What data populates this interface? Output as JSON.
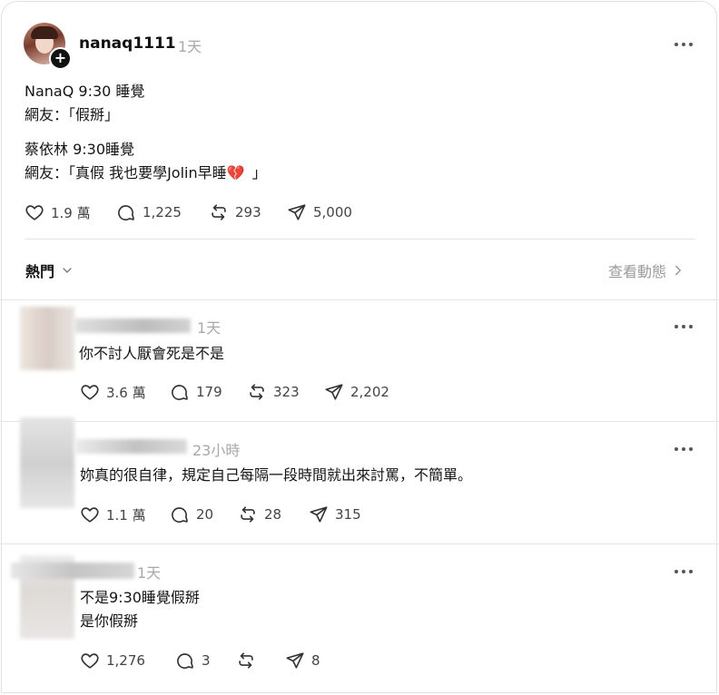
{
  "post": {
    "username": "nanaq1111",
    "time": "1天",
    "lines": [
      "NanaQ 9:30 睡覺",
      "網友：「假掰」",
      "蔡依林 9:30睡覺",
      "網友：「真假 我也要學Jolin早睡",
      "」"
    ],
    "heart_emoji": "💔",
    "likes": "1.9 萬",
    "replies": "1,225",
    "reposts": "293",
    "shares": "5,000"
  },
  "sort": {
    "label": "熱門",
    "activity_link": "查看動態"
  },
  "comments": [
    {
      "time": "1天",
      "lines": [
        "你不討人厭會死是不是"
      ],
      "likes": "3.6 萬",
      "replies": "179",
      "reposts": "323",
      "shares": "2,202"
    },
    {
      "time": "23小時",
      "lines": [
        "妳真的很自律，規定自己每隔一段時間就出來討罵，不簡單。"
      ],
      "likes": "1.1 萬",
      "replies": "20",
      "reposts": "28",
      "shares": "315"
    },
    {
      "time": "1天",
      "lines": [
        "不是9:30睡覺假掰",
        "是你假掰"
      ],
      "likes": "1,276",
      "replies": "3",
      "reposts": "",
      "shares": "8"
    }
  ]
}
